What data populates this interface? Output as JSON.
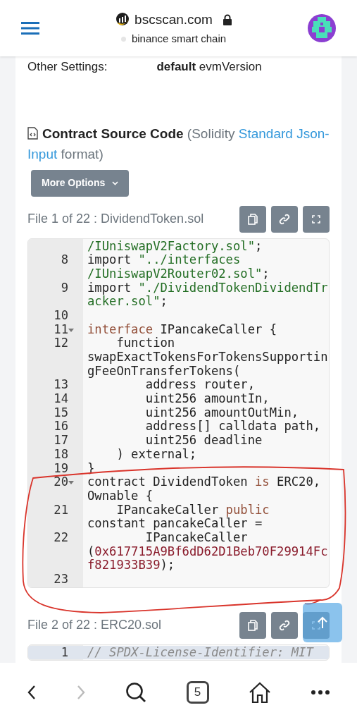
{
  "browser_header": {
    "domain": "bscscan.com",
    "subtitle": "binance smart chain"
  },
  "settings_row": {
    "label": "Other Settings:",
    "value_bold": "default",
    "value": "evmVersion"
  },
  "source_heading": {
    "title": "Contract Source Code",
    "open": "(Solidity ",
    "link": "Standard Json-Input",
    "close": " format)"
  },
  "more_options": {
    "label": "More Options"
  },
  "files": [
    {
      "title": "File 1 of 22 : DividendToken.sol",
      "rows": [
        {
          "number": "",
          "fold": false,
          "active": false,
          "segments": [
            {
              "kind": "string",
              "text": "/IUniswapV2Factory.sol\""
            },
            {
              "kind": "plain",
              "text": ";"
            }
          ]
        },
        {
          "number": "8",
          "fold": false,
          "active": false,
          "segments": [
            {
              "kind": "plain",
              "text": "import "
            },
            {
              "kind": "string",
              "text": "\"../interfaces"
            }
          ]
        },
        {
          "number": "",
          "fold": false,
          "active": false,
          "segments": [
            {
              "kind": "string",
              "text": "/IUniswapV2Router02.sol\""
            },
            {
              "kind": "plain",
              "text": ";"
            }
          ]
        },
        {
          "number": "9",
          "fold": false,
          "active": false,
          "segments": [
            {
              "kind": "plain",
              "text": "import "
            },
            {
              "kind": "string",
              "text": "\"./DividendTokenDividendTr"
            }
          ]
        },
        {
          "number": "",
          "fold": false,
          "active": false,
          "segments": [
            {
              "kind": "string",
              "text": "acker.sol\""
            },
            {
              "kind": "plain",
              "text": ";"
            }
          ]
        },
        {
          "number": "10",
          "fold": false,
          "active": false,
          "segments": []
        },
        {
          "number": "11",
          "fold": true,
          "active": false,
          "segments": [
            {
              "kind": "keyword",
              "text": "interface"
            },
            {
              "kind": "plain",
              "text": " IPancakeCaller {"
            }
          ]
        },
        {
          "number": "12",
          "fold": false,
          "active": false,
          "segments": [
            {
              "kind": "plain",
              "text": "    function"
            }
          ]
        },
        {
          "number": "",
          "fold": false,
          "active": false,
          "segments": [
            {
              "kind": "plain",
              "text": "swapExactTokensForTokensSupportin"
            }
          ]
        },
        {
          "number": "",
          "fold": false,
          "active": false,
          "segments": [
            {
              "kind": "plain",
              "text": "gFeeOnTransferTokens("
            }
          ]
        },
        {
          "number": "13",
          "fold": false,
          "active": false,
          "segments": [
            {
              "kind": "plain",
              "text": "        address router,"
            }
          ]
        },
        {
          "number": "14",
          "fold": false,
          "active": false,
          "segments": [
            {
              "kind": "plain",
              "text": "        uint256 amountIn,"
            }
          ]
        },
        {
          "number": "15",
          "fold": false,
          "active": false,
          "segments": [
            {
              "kind": "plain",
              "text": "        uint256 amountOutMin,"
            }
          ]
        },
        {
          "number": "16",
          "fold": false,
          "active": false,
          "segments": [
            {
              "kind": "plain",
              "text": "        address[] calldata path,"
            }
          ]
        },
        {
          "number": "17",
          "fold": false,
          "active": false,
          "segments": [
            {
              "kind": "plain",
              "text": "        uint256 deadline"
            }
          ]
        },
        {
          "number": "18",
          "fold": false,
          "active": false,
          "segments": [
            {
              "kind": "plain",
              "text": "    ) external;"
            }
          ]
        },
        {
          "number": "19",
          "fold": false,
          "active": false,
          "segments": [
            {
              "kind": "plain",
              "text": "}"
            }
          ]
        },
        {
          "number": "20",
          "fold": true,
          "active": false,
          "segments": [
            {
              "kind": "plain",
              "text": "contract DividendToken "
            },
            {
              "kind": "keyword",
              "text": "is"
            },
            {
              "kind": "plain",
              "text": " ERC20,"
            }
          ]
        },
        {
          "number": "",
          "fold": false,
          "active": false,
          "segments": [
            {
              "kind": "plain",
              "text": "Ownable {"
            }
          ]
        },
        {
          "number": "21",
          "fold": false,
          "active": false,
          "segments": [
            {
              "kind": "plain",
              "text": "    IPancakeCaller "
            },
            {
              "kind": "keyword",
              "text": "public"
            }
          ]
        },
        {
          "number": "",
          "fold": false,
          "active": false,
          "segments": [
            {
              "kind": "plain",
              "text": "constant pancakeCaller ="
            }
          ]
        },
        {
          "number": "22",
          "fold": false,
          "active": false,
          "segments": [
            {
              "kind": "plain",
              "text": "        IPancakeCaller"
            }
          ]
        },
        {
          "number": "",
          "fold": false,
          "active": false,
          "segments": [
            {
              "kind": "plain",
              "text": "("
            },
            {
              "kind": "number",
              "text": "0x617715A9Bf6dD62D1Beb70F29914Fc"
            }
          ]
        },
        {
          "number": "",
          "fold": false,
          "active": false,
          "segments": [
            {
              "kind": "number",
              "text": "f821933B39"
            },
            {
              "kind": "plain",
              "text": ");"
            }
          ]
        },
        {
          "number": "23",
          "fold": false,
          "active": false,
          "segments": []
        }
      ]
    },
    {
      "title": "File 2 of 22 : ERC20.sol",
      "rows": [
        {
          "number": "1",
          "fold": false,
          "active": true,
          "segments": [
            {
              "kind": "comment",
              "text": "// SPDX-License-Identifier: MIT"
            }
          ]
        }
      ]
    }
  ],
  "tab_count": "5"
}
